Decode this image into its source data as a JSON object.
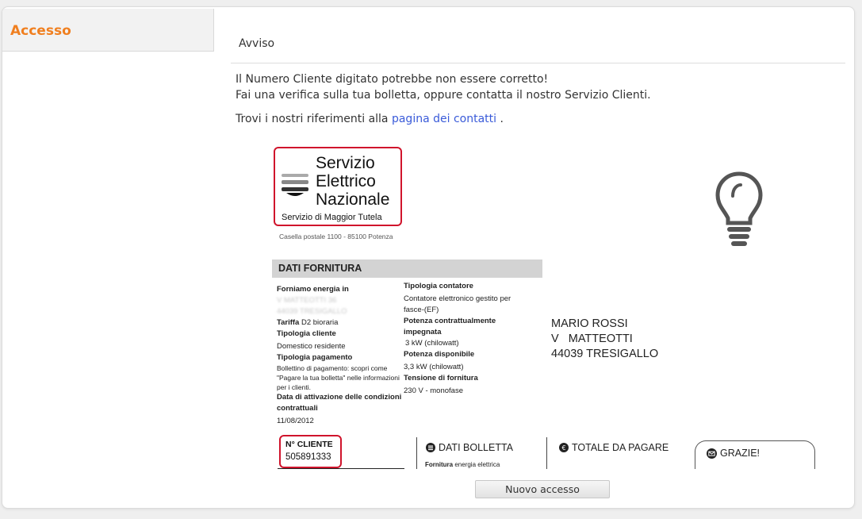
{
  "sidebar": {
    "tab_label": "Accesso"
  },
  "main": {
    "heading": "Avviso",
    "message_line1": "Il Numero Cliente digitato potrebbe non essere corretto!",
    "message_line2": "Fai una verifica sulla tua bolletta, oppure contatta il nostro Servizio Clienti.",
    "contacts_prefix": "Trovi i nostri riferimenti alla",
    "contacts_link": "pagina dei contatti",
    "contacts_suffix": "."
  },
  "bill": {
    "logo_lines": [
      "Servizio",
      "Elettrico",
      "Nazionale"
    ],
    "logo_subtitle": "Servizio di Maggior Tutela",
    "logo_address": "Casella postale 1100 - 85100 Potenza",
    "section_title": "DATI FORNITURA",
    "col1": {
      "forniamo_label": "Forniamo energia in",
      "forniamo_value_1": "V MATTEOTTI 36",
      "forniamo_value_2": "44039 TRESIGALLO",
      "tariffa_label": "Tariffa",
      "tariffa_value": "D2 bioraria",
      "tipologia_cliente_label": "Tipologia cliente",
      "tipologia_cliente_value": "Domestico residente",
      "tipologia_pagamento_label": "Tipologia pagamento",
      "tipologia_pagamento_value": "Bollettino di pagamento: scopri come \"Pagare la tua bolletta\" nelle informazioni per i clienti.",
      "data_attivazione_label": "Data di attivazione delle condizioni contrattuali",
      "data_attivazione_value": "11/08/2012"
    },
    "col2": {
      "contatore_label": "Tipologia contatore",
      "contatore_value": "Contatore elettronico gestito per fasce-(EF)",
      "potenza_impegnata_label": "Potenza contrattualmente impegnata",
      "potenza_impegnata_value": "3 kW (chilowatt)",
      "potenza_disponibile_label": "Potenza disponibile",
      "potenza_disponibile_value": "3,3 kW (chilowatt)",
      "tensione_label": "Tensione di fornitura",
      "tensione_value": "230 V - monofase"
    },
    "address": {
      "name": "MARIO ROSSI",
      "street": "V   MATTEOTTI",
      "city": "44039 TRESIGALLO"
    },
    "cliente_label": "N° CLIENTE",
    "cliente_value": "505891333",
    "dati_bolletta_title": "DATI BOLLETTA",
    "fornitura_label": "Fornitura",
    "fornitura_value": "energia elettrica",
    "totale_title": "TOTALE DA PAGARE",
    "grazie_title": "GRAZIE!"
  },
  "actions": {
    "new_access": "Nuovo accesso"
  },
  "colors": {
    "accent": "#f07f1f",
    "highlight": "#d0142c",
    "link": "#3a5bd9"
  }
}
